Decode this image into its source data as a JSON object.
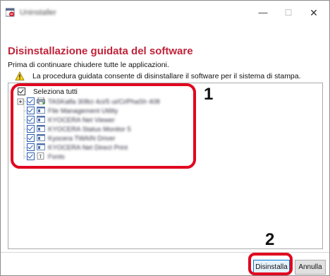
{
  "window": {
    "title": "Uninstaller",
    "minimize_glyph": "—",
    "maximize_glyph": "☐",
    "close_glyph": "✕"
  },
  "header": {
    "title": "Disinstallazione guidata del software",
    "subtitle": "Prima di continuare chiudere tutte le applicazioni.",
    "info_text": "La procedura guidata consente di disinstallare il software per il sistema di stampa."
  },
  "tree": {
    "select_all_label": "Seleziona tutti",
    "select_all_checked": true,
    "items": [
      {
        "label": "TASKalfa 308ci 4ci/5 ui/Ci/PhaSh 408",
        "checked": true,
        "icon": "printer-icon"
      },
      {
        "label": "File Management Utility",
        "checked": true,
        "icon": "app-icon"
      },
      {
        "label": "KYOCERA Net Viewer",
        "checked": true,
        "icon": "app-icon"
      },
      {
        "label": "KYOCERA Status Monitor 5",
        "checked": true,
        "icon": "app-icon"
      },
      {
        "label": "Kyocera TWAIN Driver",
        "checked": true,
        "icon": "app-icon"
      },
      {
        "label": "KYOCERA Net Direct Print",
        "checked": true,
        "icon": "app-icon"
      },
      {
        "label": "Fonts",
        "checked": true,
        "icon": "font-icon"
      }
    ]
  },
  "callouts": {
    "step1": "1",
    "step2": "2"
  },
  "buttons": {
    "uninstall": "Disinstalla",
    "cancel": "Annulla"
  },
  "colors": {
    "title_red": "#c0233a",
    "callout_red": "#e1061f",
    "primary_button_border": "#0078d7"
  }
}
